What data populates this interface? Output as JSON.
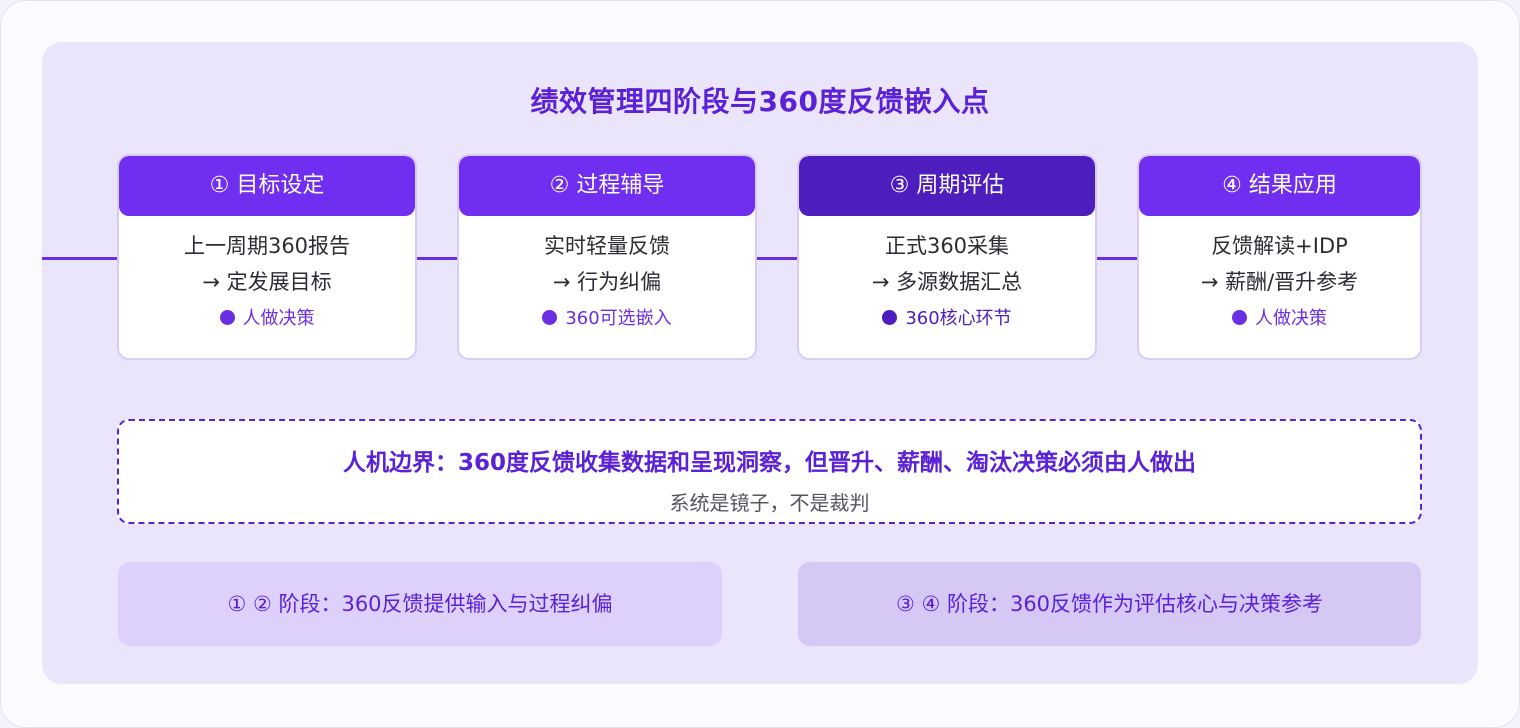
{
  "title": "绩效管理四阶段与360度反馈嵌入点",
  "stages": [
    {
      "header": "① 目标设定",
      "line1": "上一周期360报告",
      "line2": "→ 定发展目标",
      "note": "人做决策"
    },
    {
      "header": "② 过程辅导",
      "line1": "实时轻量反馈",
      "line2": "→ 行为纠偏",
      "note": "360可选嵌入"
    },
    {
      "header": "③ 周期评估",
      "line1": "正式360采集",
      "line2": "→ 多源数据汇总",
      "note": "360核心环节"
    },
    {
      "header": "④ 结果应用",
      "line1": "反馈解读+IDP",
      "line2": "→ 薪酬/晋升参考",
      "note": "人做决策"
    }
  ],
  "boundary": {
    "main": "人机边界：360度反馈收集数据和呈现洞察，但晋升、薪酬、淘汰决策必须由人做出",
    "sub": "系统是镜子，不是裁判"
  },
  "phases": {
    "left": "① ② 阶段：360反馈提供输入与过程纠偏",
    "right": "③ ④ 阶段：360反馈作为评估核心与决策参考"
  },
  "colors": {
    "accent": "#6f2ef0",
    "accent_dark": "#4d1dbd",
    "panel_bg": "#ebe5fc"
  }
}
